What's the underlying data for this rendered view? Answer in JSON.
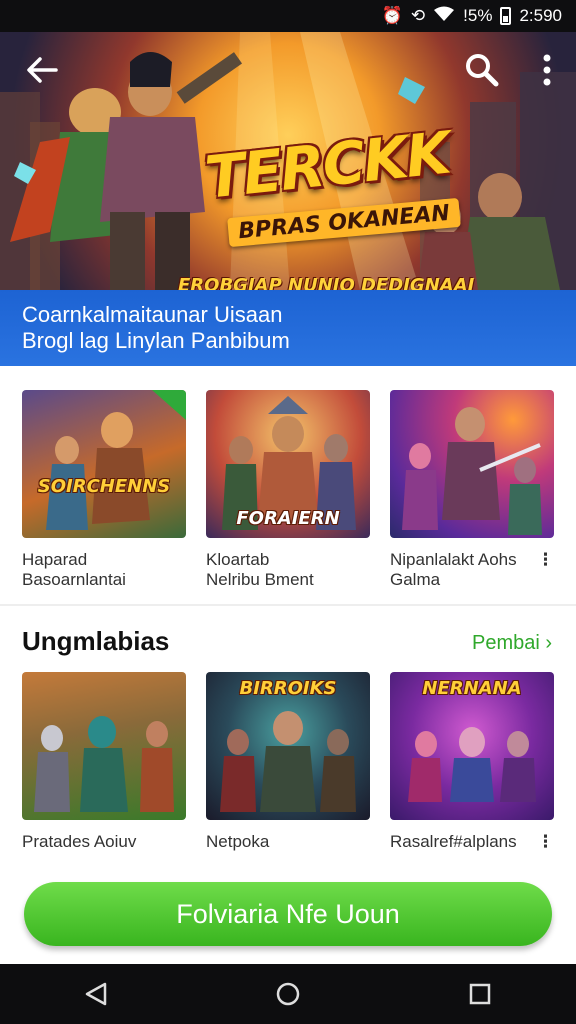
{
  "status_bar": {
    "battery_text": "!5%",
    "time": "2:590"
  },
  "hero": {
    "title": "ΤERCKK",
    "subtitle": "BPRAS OKANEAN",
    "tagline": "EROBGIAP NUNIO DEDIGNAAI"
  },
  "band": {
    "line1": "Coarnkalmaitaunar Uisaan",
    "line2": "Brogl lag Linylan Panbibum"
  },
  "row1": [
    {
      "thumb_text": "SOIRCHENNS",
      "title_l1": "Haparad",
      "title_l2": "Basoarnlantai",
      "badge": ""
    },
    {
      "thumb_text": "FORAIERN",
      "title_l1": "Kloartab",
      "title_l2": "Nelribu Bment",
      "badge": ""
    },
    {
      "thumb_text": "",
      "title_l1": "Nipanlalakt Aohs",
      "title_l2": "Galma",
      "badge": ""
    }
  ],
  "section": {
    "title": "Ungmlabias",
    "link": "Pembai ›"
  },
  "row2": [
    {
      "thumb_text": "",
      "title_l1": "Pratades Aoiuv",
      "title_l2": "",
      "badge": ""
    },
    {
      "thumb_text": "BIRROIKS",
      "title_l1": "Netpoka",
      "title_l2": "",
      "badge": ""
    },
    {
      "thumb_text": "NERNANA",
      "title_l1": "Rasalref#alplans",
      "title_l2": "",
      "badge": ""
    }
  ],
  "cta": {
    "label": "Folviaria Nfe Uoun"
  },
  "icons": {
    "back": "arrow-left-icon",
    "search": "search-icon",
    "more": "more-vert-icon",
    "nav_back": "triangle-back-icon",
    "nav_home": "circle-home-icon",
    "nav_recents": "square-recents-icon"
  },
  "colors": {
    "band": "#1d63d3",
    "accent_green": "#39b51f",
    "link_green": "#2fa82b"
  }
}
